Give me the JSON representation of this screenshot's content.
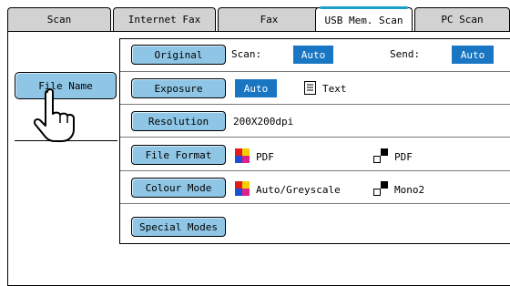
{
  "tabs": [
    {
      "label": "Scan",
      "active": false
    },
    {
      "label": "Internet Fax",
      "active": false
    },
    {
      "label": "Fax",
      "active": false
    },
    {
      "label": "USB Mem. Scan",
      "active": true
    },
    {
      "label": "PC Scan",
      "active": false
    }
  ],
  "left": {
    "file_name_label": "File Name"
  },
  "original": {
    "label": "Original",
    "scan_label": "Scan:",
    "scan_value": "Auto",
    "send_label": "Send:",
    "send_value": "Auto"
  },
  "exposure": {
    "label": "Exposure",
    "value": "Auto",
    "mode": "Text"
  },
  "resolution": {
    "label": "Resolution",
    "value": "200X200dpi"
  },
  "file_format": {
    "label": "File Format",
    "color_value": "PDF",
    "mono_value": "PDF"
  },
  "colour_mode": {
    "label": "Colour Mode",
    "color_value": "Auto/Greyscale",
    "mono_value": "Mono2"
  },
  "special_modes": {
    "label": "Special Modes"
  },
  "colors": {
    "button": "#8fc6e6",
    "selected": "#1976c2",
    "tab_bg": "#d2d2d2",
    "tab_highlight": "#1aa0c8"
  },
  "icons": [
    "pointing-hand-icon",
    "text-document-icon",
    "color-squares-icon",
    "mono-squares-icon"
  ]
}
